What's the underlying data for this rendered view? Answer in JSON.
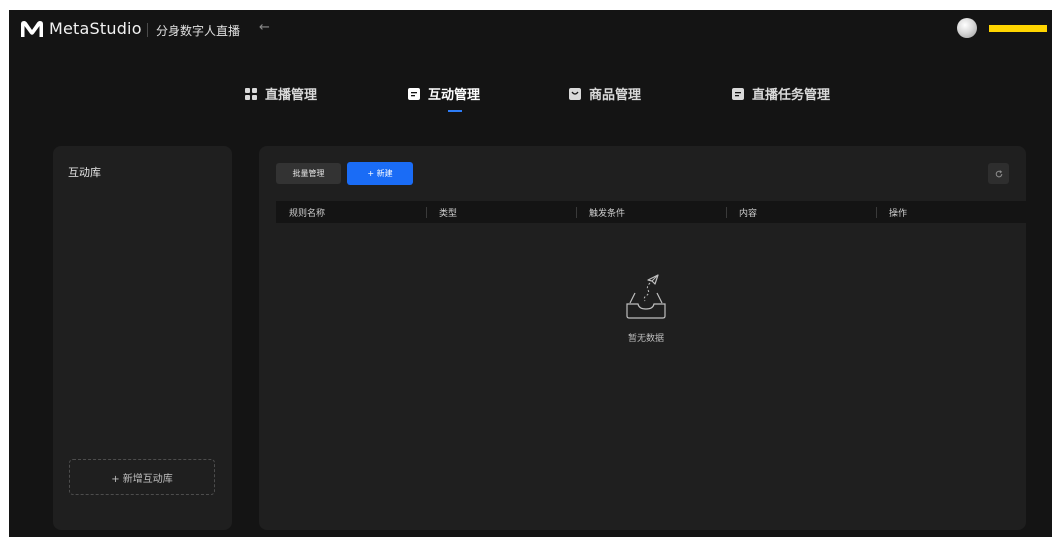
{
  "header": {
    "brand": "MetaStudio",
    "subtitle": "分身数字人直播",
    "back_icon": "←"
  },
  "tabs": [
    {
      "label": "直播管理",
      "icon": "grid-icon",
      "active": false
    },
    {
      "label": "互动管理",
      "icon": "document-icon",
      "active": true
    },
    {
      "label": "商品管理",
      "icon": "product-icon",
      "active": false
    },
    {
      "label": "直播任务管理",
      "icon": "document-icon",
      "active": false
    }
  ],
  "left_panel": {
    "title": "互动库",
    "add_button": "+ 新增互动库"
  },
  "main": {
    "batch_button": "批量管理",
    "new_button": "+ 新建",
    "columns": [
      "规则名称",
      "类型",
      "触发条件",
      "内容",
      "操作"
    ],
    "empty_text": "暂无数据"
  },
  "colors": {
    "accent": "#1a6cf6",
    "background": "#141414",
    "panel": "#1f1f1f",
    "username_bar": "#ffd500"
  }
}
